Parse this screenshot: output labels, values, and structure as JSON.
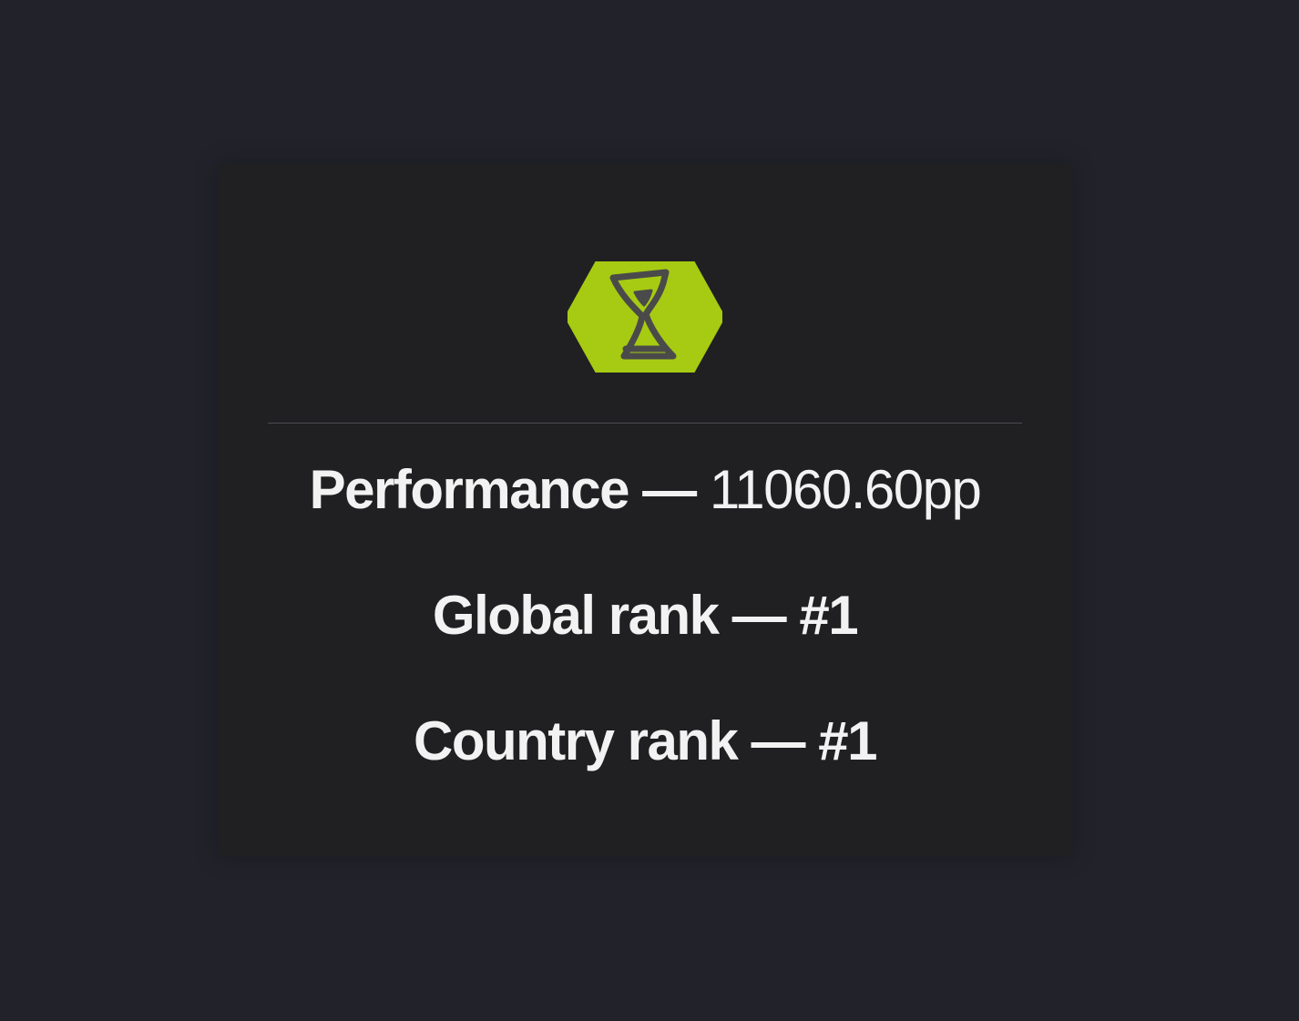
{
  "badge": {
    "icon": "hourglass-icon",
    "color": "#a6cb12",
    "icon_color": "#4a4a4a"
  },
  "stats": {
    "performance": {
      "label": "Performance",
      "separator": " — ",
      "value": "11060.60pp"
    },
    "global_rank": {
      "label": "Global rank",
      "separator": " — ",
      "value": "#1"
    },
    "country_rank": {
      "label": "Country rank",
      "separator": " — ",
      "value": "#1"
    }
  }
}
